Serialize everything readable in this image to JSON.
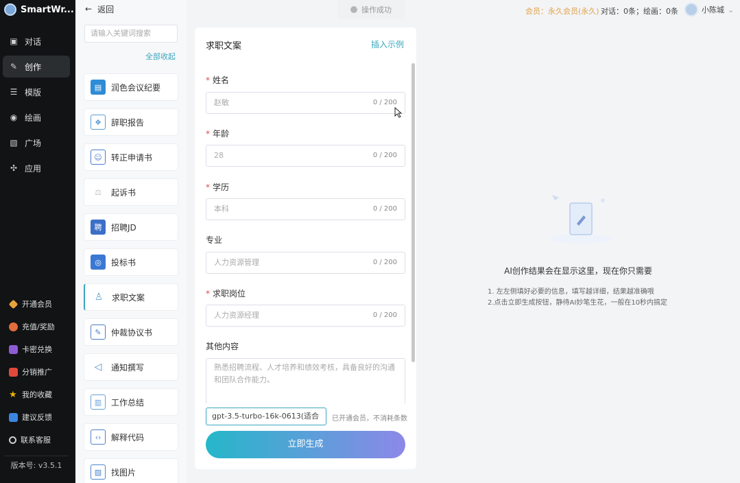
{
  "brand": {
    "name": "SmartWr..."
  },
  "nav": [
    {
      "label": "对话",
      "icon": "chat-icon"
    },
    {
      "label": "创作",
      "icon": "pen-icon",
      "active": true
    },
    {
      "label": "模版",
      "icon": "list-icon"
    },
    {
      "label": "绘画",
      "icon": "palette-icon"
    },
    {
      "label": "广场",
      "icon": "image-icon"
    },
    {
      "label": "应用",
      "icon": "apps-icon"
    }
  ],
  "bottom_nav": [
    {
      "label": "开通会员",
      "color": "#e6a23c"
    },
    {
      "label": "充值/奖励",
      "color": "#e26d3c"
    },
    {
      "label": "卡密兑换",
      "color": "#8e5bd6"
    },
    {
      "label": "分销推广",
      "color": "#e04a3c"
    },
    {
      "label": "我的收藏",
      "color": "#f0b400"
    },
    {
      "label": "建议反馈",
      "color": "#3b86e0"
    },
    {
      "label": "联系客服",
      "color": "#cfcfcf"
    }
  ],
  "version": "版本号: v3.5.1",
  "tools_panel": {
    "back_label": "返回",
    "search_placeholder": "请输入关键词搜索",
    "collapse_label": "全部收起",
    "items": [
      {
        "label": "润色会议纪要",
        "color": "#2f8cd6"
      },
      {
        "label": "辞职报告",
        "color": "#5b9bd5"
      },
      {
        "label": "转正申请书",
        "color": "#4a7bd0"
      },
      {
        "label": "起诉书",
        "color": "#b8c2cc"
      },
      {
        "label": "招聘JD",
        "color": "#3b6fc8"
      },
      {
        "label": "投标书",
        "color": "#3a78d4"
      },
      {
        "label": "求职文案",
        "color": "#5aa3d6",
        "active": true
      },
      {
        "label": "仲裁协议书",
        "color": "#4c7ebd"
      },
      {
        "label": "通知撰写",
        "color": "#4a88cf"
      },
      {
        "label": "工作总结",
        "color": "#6aa0d8"
      },
      {
        "label": "解释代码",
        "color": "#4e7fc4"
      },
      {
        "label": "找图片",
        "color": "#4b86cf"
      }
    ]
  },
  "topbar": {
    "toast": "操作成功",
    "member": "会员：永久会员(永久)",
    "counts": "对话：0条；绘画：0条",
    "username": "小陈城"
  },
  "form": {
    "title": "求职文案",
    "insert_example": "插入示例",
    "fields": [
      {
        "label": "姓名",
        "required": true,
        "placeholder": "赵敏",
        "count": "0 / 200"
      },
      {
        "label": "年龄",
        "required": true,
        "placeholder": "28",
        "count": "0 / 200"
      },
      {
        "label": "学历",
        "required": true,
        "placeholder": "本科",
        "count": "0 / 200"
      },
      {
        "label": "专业",
        "required": false,
        "placeholder": "人力资源管理",
        "count": "0 / 200"
      },
      {
        "label": "求职岗位",
        "required": true,
        "placeholder": "人力资源经理",
        "count": "0 / 200"
      }
    ],
    "other_label": "其他内容",
    "other_placeholder": "熟悉招聘流程、人才培养和绩效考核，具备良好的沟通和团队合作能力。",
    "model": "gpt-3.5-turbo-16k-0613(适合",
    "model_note": "已开通会员，不消耗条数",
    "generate": "立即生成"
  },
  "result": {
    "title": "AI创作结果会在显示这里，现在你只需要",
    "lines": [
      "1. 左左侧填好必要的信息，填写越详细，结果越准确哦",
      "2.点击立即生成按钮，静待AI妙笔生花，一般在10秒内搞定"
    ]
  }
}
